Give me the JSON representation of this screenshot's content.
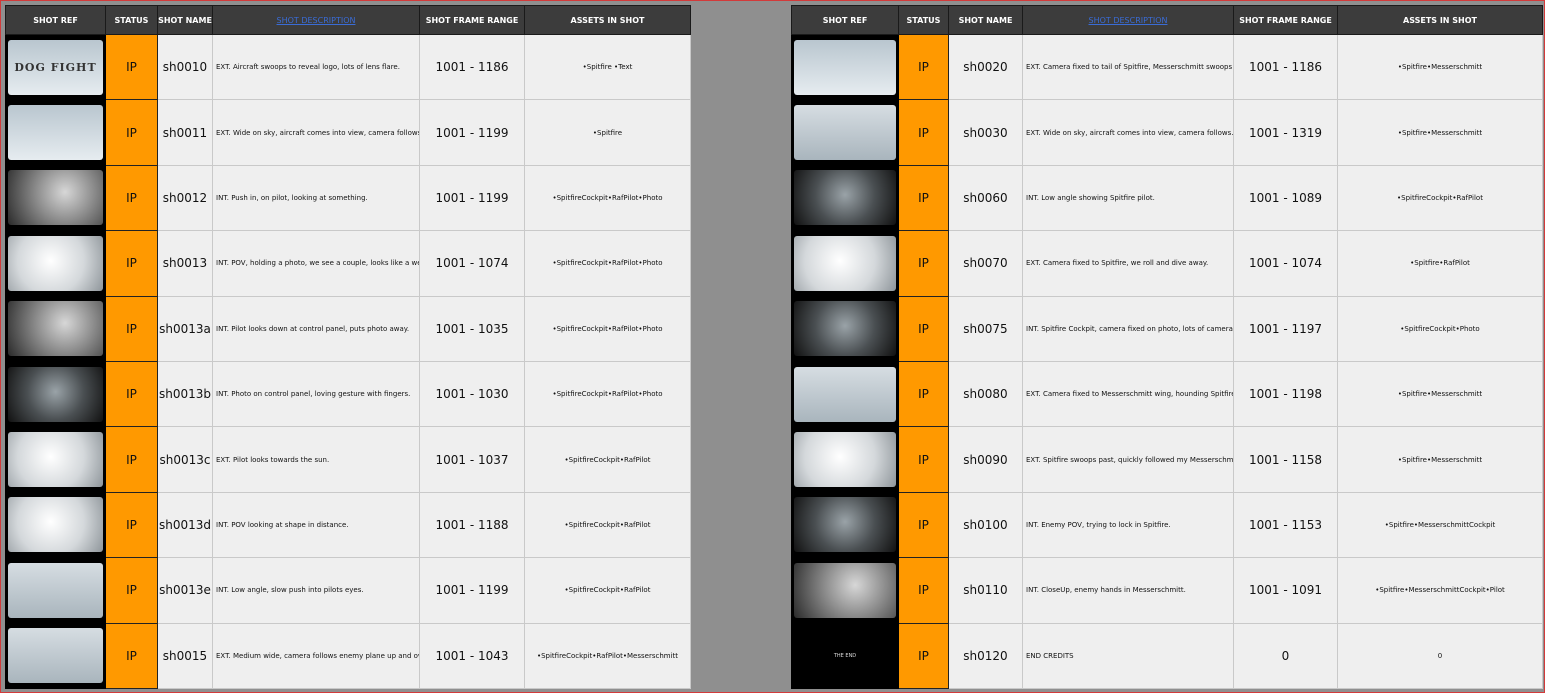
{
  "headers": {
    "shot_ref": "SHOT REF",
    "status": "STATUS",
    "shot_name": "SHOT NAME",
    "shot_description": "SHOT DESCRIPTION",
    "frame_range": "SHOT FRAME RANGE",
    "assets": "ASSETS IN SHOT"
  },
  "thumb_logo_text": "DOG FIGHT",
  "thumb_end_text": "THE END",
  "colors": {
    "status_ip": "#ff9900",
    "header_bg": "#3c3c3c",
    "frame_red": "#d23a3a"
  },
  "left_rows": [
    {
      "status": "IP",
      "name": "sh0010",
      "desc": "EXT. Aircraft swoops to reveal logo, lots of lens flare.",
      "range": "1001 - 1186",
      "assets": "•Spitfire •Text"
    },
    {
      "status": "IP",
      "name": "sh0011",
      "desc": "EXT. Wide on sky, aircraft comes into view, camera follows.",
      "range": "1001 - 1199",
      "assets": "•Spitfire"
    },
    {
      "status": "IP",
      "name": "sh0012",
      "desc": "INT. Push in, on pilot, looking at something.",
      "range": "1001 - 1199",
      "assets": "•SpitfireCockpit•RafPilot•Photo"
    },
    {
      "status": "IP",
      "name": "sh0013",
      "desc": "INT. POV, holding a photo, we see a couple, looks like a wedding.",
      "range": "1001 - 1074",
      "assets": "•SpitfireCockpit•RafPilot•Photo"
    },
    {
      "status": "IP",
      "name": "sh0013a",
      "desc": "INT. Pilot looks down at control panel, puts photo away.",
      "range": "1001 - 1035",
      "assets": "•SpitfireCockpit•RafPilot•Photo"
    },
    {
      "status": "IP",
      "name": "sh0013b",
      "desc": "INT. Photo on control panel, loving gesture with fingers.",
      "range": "1001 - 1030",
      "assets": "•SpitfireCockpit•RafPilot•Photo"
    },
    {
      "status": "IP",
      "name": "sh0013c",
      "desc": "EXT. Pilot looks towards the sun.",
      "range": "1001 - 1037",
      "assets": "•SpitfireCockpit•RafPilot"
    },
    {
      "status": "IP",
      "name": "sh0013d",
      "desc": "INT. POV looking at shape in distance.",
      "range": "1001 - 1188",
      "assets": "•SpitfireCockpit•RafPilot"
    },
    {
      "status": "IP",
      "name": "sh0013e",
      "desc": "INT. Low angle, slow push into pilots eyes.",
      "range": "1001 - 1199",
      "assets": "•SpitfireCockpit•RafPilot"
    },
    {
      "status": "IP",
      "name": "sh0015",
      "desc": "EXT. Medium wide, camera follows enemy plane up and over cockpit.",
      "range": "1001 - 1043",
      "assets": "•SpitfireCockpit•RafPilot•Messerschmitt"
    }
  ],
  "right_rows": [
    {
      "status": "IP",
      "name": "sh0020",
      "desc": "EXT. Camera fixed to tail of Spitfire, Messerschmitt swoops into view.",
      "range": "1001 - 1186",
      "assets": "•Spitfire•Messerschmitt"
    },
    {
      "status": "IP",
      "name": "sh0030",
      "desc": "EXT. Wide on sky, aircraft comes into view, camera follows.",
      "range": "1001 - 1319",
      "assets": "•Spitfire•Messerschmitt"
    },
    {
      "status": "IP",
      "name": "sh0060",
      "desc": "INT. Low angle showing Spitfire pilot.",
      "range": "1001 - 1089",
      "assets": "•SpitfireCockpit•RafPilot"
    },
    {
      "status": "IP",
      "name": "sh0070",
      "desc": "EXT. Camera fixed to Spitfire, we roll and dive away.",
      "range": "1001 - 1074",
      "assets": "•Spitfire•RafPilot"
    },
    {
      "status": "IP",
      "name": "sh0075",
      "desc": "INT. Spitfire Cockpit, camera fixed on photo, lots of camera shake.",
      "range": "1001 - 1197",
      "assets": "•SpitfireCockpit•Photo"
    },
    {
      "status": "IP",
      "name": "sh0080",
      "desc": "EXT. Camera fixed to Messerschmitt wing, hounding Spitfire.",
      "range": "1001 - 1198",
      "assets": "•Spitfire•Messerschmitt"
    },
    {
      "status": "IP",
      "name": "sh0090",
      "desc": "EXT. Spitfire swoops past, quickly followed my Messerschmitt.",
      "range": "1001 - 1158",
      "assets": "•Spitfire•Messerschmitt"
    },
    {
      "status": "IP",
      "name": "sh0100",
      "desc": "INT. Enemy POV, trying to lock in Spitfire.",
      "range": "1001 - 1153",
      "assets": "•Spitfire•MesserschmittCockpit"
    },
    {
      "status": "IP",
      "name": "sh0110",
      "desc": "INT. CloseUp, enemy hands in Messerschmitt.",
      "range": "1001 - 1091",
      "assets": "•Spitfire•MesserschmittCockpit•Pilot"
    },
    {
      "status": "IP",
      "name": "sh0120",
      "desc": "END CREDITS",
      "range": "0",
      "assets": "0"
    }
  ]
}
